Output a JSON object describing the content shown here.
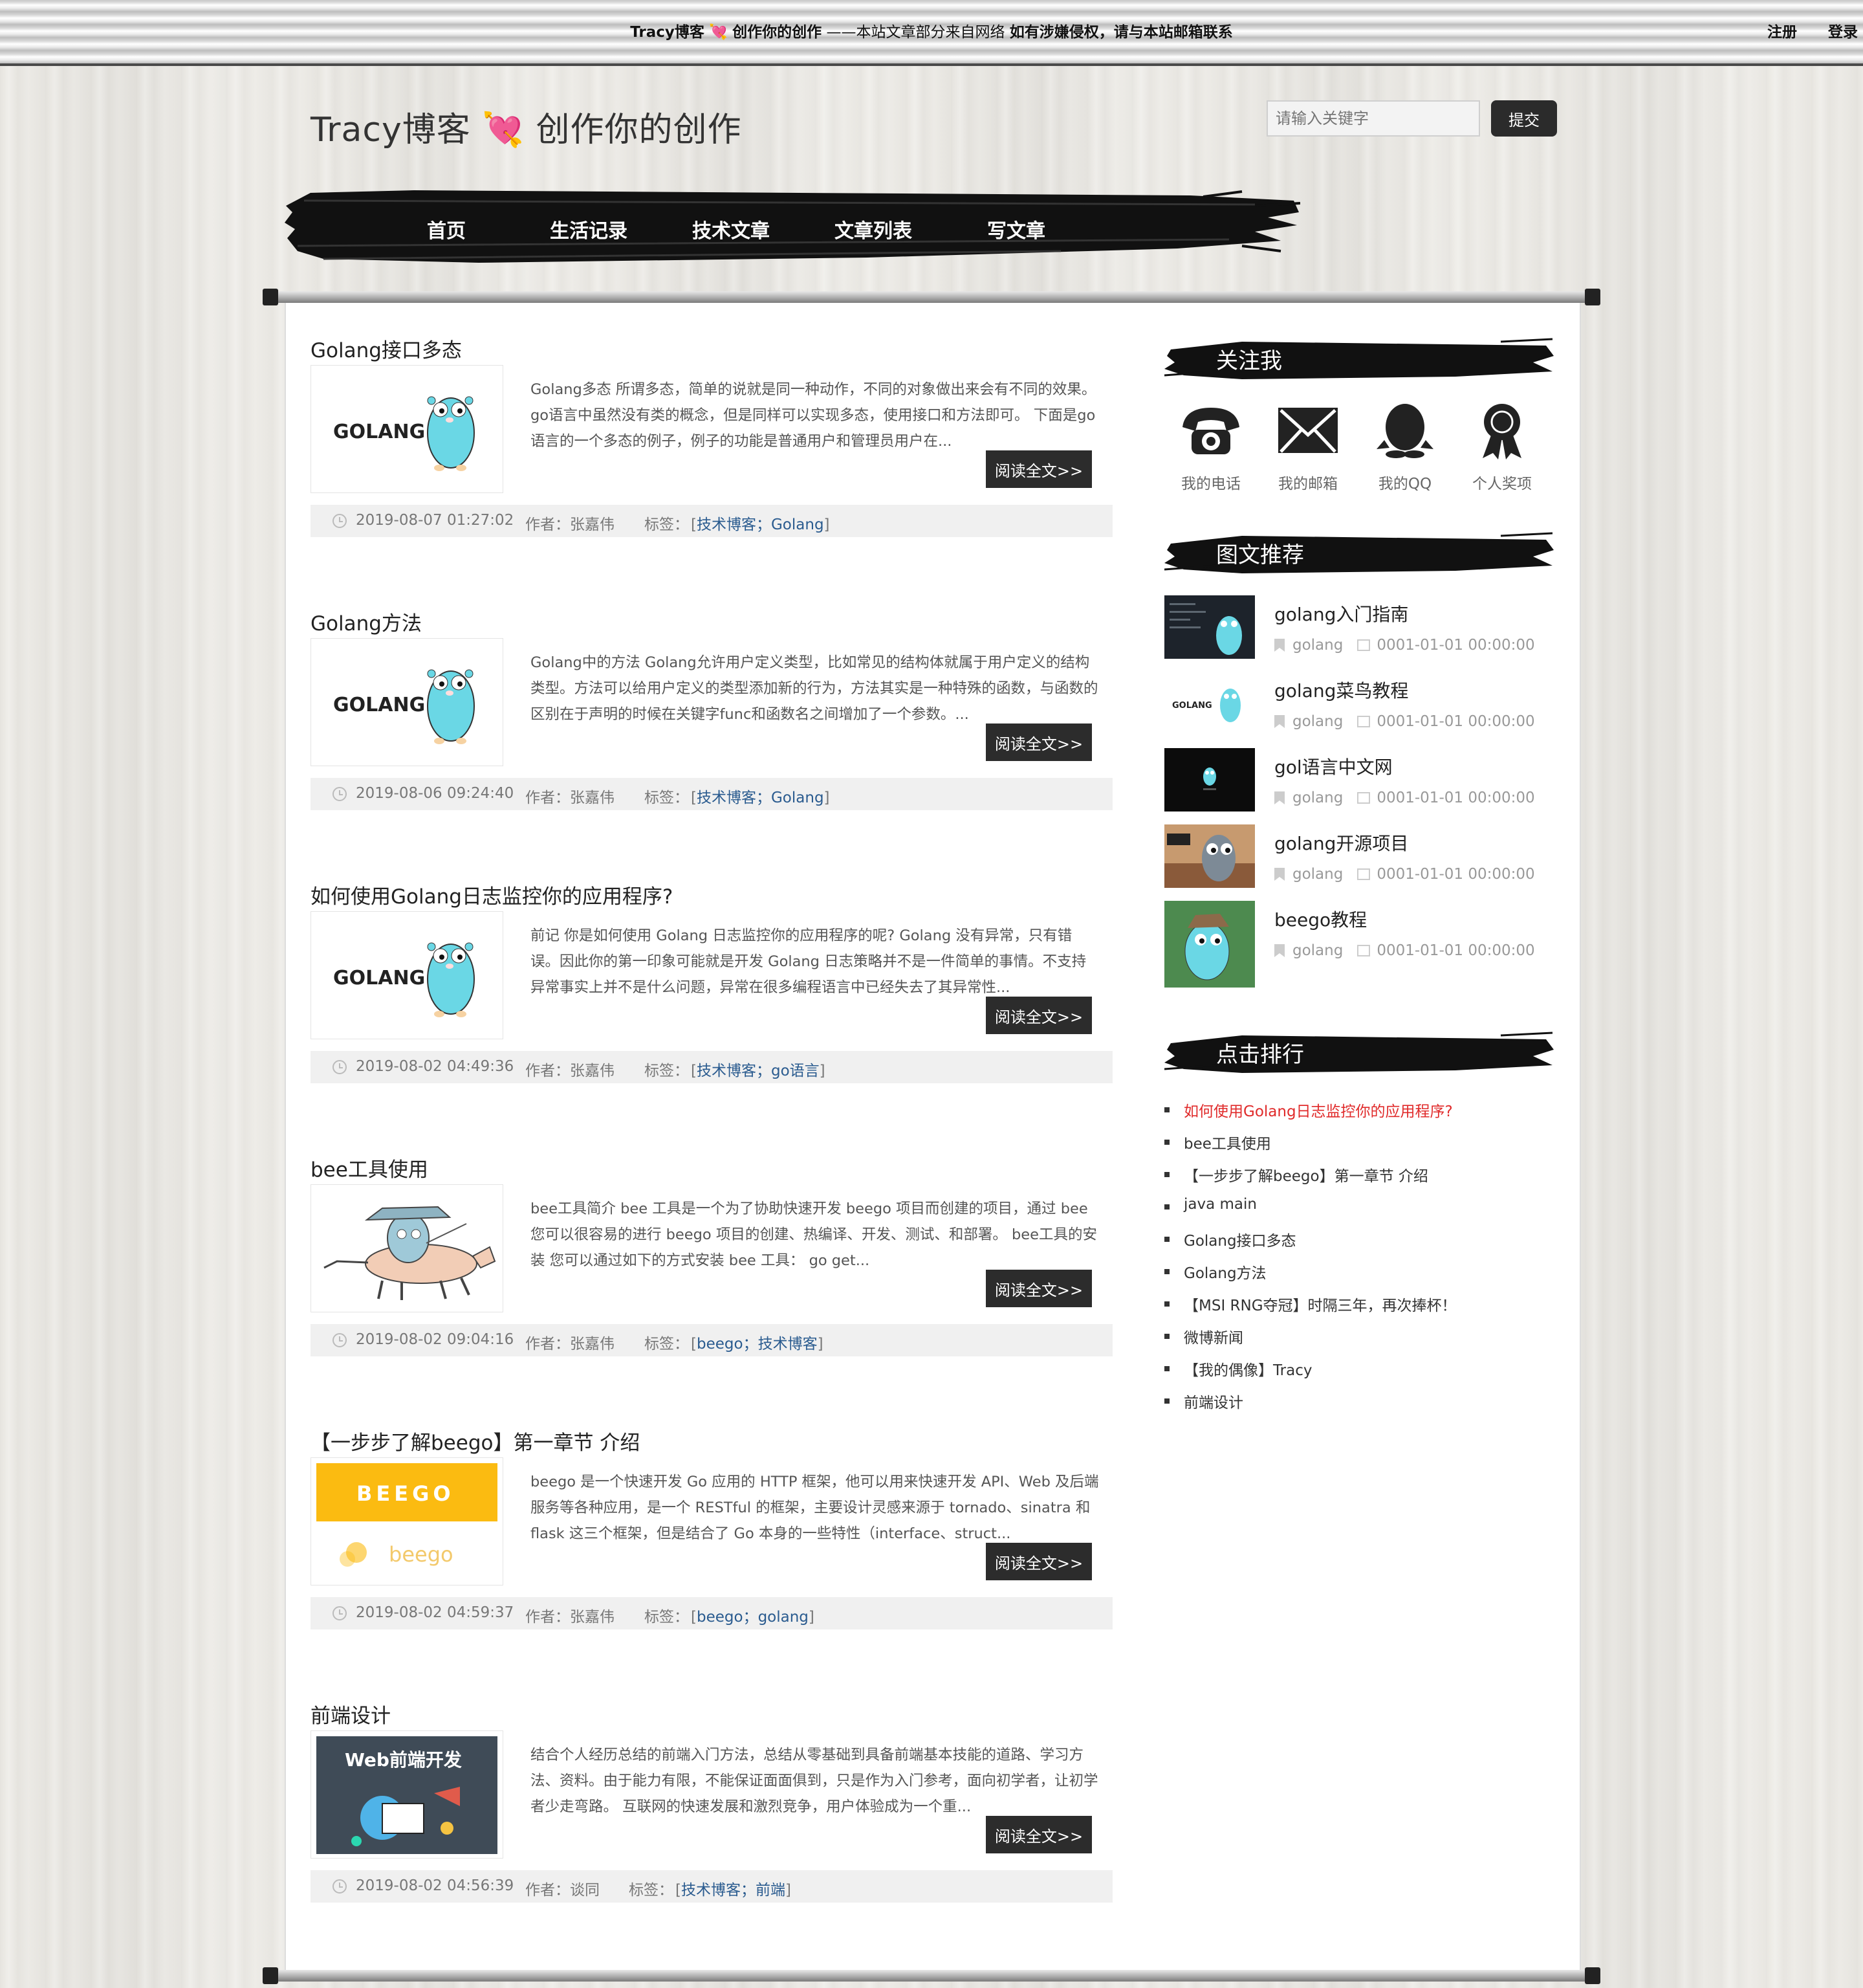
{
  "topbar": {
    "site_name": "Tracy博客",
    "heart": "💘",
    "site_slogan": "创作你的创作",
    "notice_mid": "——本站文章部分来自网络",
    "notice_bold": "如有涉嫌侵权，请与本站邮箱联系",
    "register": "注册",
    "login": "登录"
  },
  "header": {
    "logo_left": "Tracy博客",
    "logo_heart": "💘",
    "logo_right": "创作你的创作",
    "search_placeholder": "请输入关键字",
    "search_button": "提交"
  },
  "nav": [
    "首页",
    "生活记录",
    "技术文章",
    "文章列表",
    "写文章"
  ],
  "articles": [
    {
      "title": "Golang接口多态",
      "thumb": "golang",
      "summary": "Golang多态 所谓多态，简单的说就是同一种动作，不同的对象做出来会有不同的效果。go语言中虽然没有类的概念，但是同样可以实现多态，使用接口和方法即可。 下面是go语言的一个多态的例子，例子的功能是普通用户和管理员用户在...",
      "read": "阅读全文>>",
      "date": "2019-08-07 01:27:02",
      "author_label": "作者：",
      "author": "张嘉伟",
      "tags_label": "标签：",
      "tags": [
        "技术博客",
        "Golang"
      ]
    },
    {
      "title": "Golang方法",
      "thumb": "golang",
      "summary": "Golang中的方法 Golang允许用户定义类型，比如常见的结构体就属于用户定义的结构类型。方法可以给用户定义的类型添加新的行为，方法其实是一种特殊的函数，与函数的区别在于声明的时候在关键字func和函数名之间增加了一个参数。...",
      "read": "阅读全文>>",
      "date": "2019-08-06 09:24:40",
      "author_label": "作者：",
      "author": "张嘉伟",
      "tags_label": "标签：",
      "tags": [
        "技术博客",
        "Golang"
      ]
    },
    {
      "title": "如何使用Golang日志监控你的应用程序?",
      "thumb": "golang",
      "summary": "前记 你是如何使用 Golang 日志监控你的应用程序的呢? Golang 没有异常，只有错误。因此你的第一印象可能就是开发 Golang 日志策略并不是一件简单的事情。不支持异常事实上并不是什么问题，异常在很多编程语言中已经失去了其异常性...",
      "read": "阅读全文>>",
      "date": "2019-08-02 04:49:36",
      "author_label": "作者：",
      "author": "张嘉伟",
      "tags_label": "标签：",
      "tags": [
        "技术博客",
        "go语言"
      ]
    },
    {
      "title": "bee工具使用",
      "thumb": "bee",
      "summary": "bee工具简介 bee 工具是一个为了协助快速开发 beego 项目而创建的项目，通过 bee 您可以很容易的进行 beego 项目的创建、热编译、开发、测试、和部署。 bee工具的安装 您可以通过如下的方式安装 bee 工具：  go get...",
      "read": "阅读全文>>",
      "date": "2019-08-02 09:04:16",
      "author_label": "作者：",
      "author": "张嘉伟",
      "tags_label": "标签：",
      "tags": [
        "beego",
        "技术博客"
      ]
    },
    {
      "title": "【一步步了解beego】第一章节 介绍",
      "thumb": "beego",
      "summary": "beego 是一个快速开发 Go 应用的 HTTP 框架，他可以用来快速开发 API、Web 及后端服务等各种应用，是一个 RESTful 的框架，主要设计灵感来源于 tornado、sinatra 和 flask 这三个框架，但是结合了 Go 本身的一些特性（interface、struct...",
      "read": "阅读全文>>",
      "date": "2019-08-02 04:59:37",
      "author_label": "作者：",
      "author": "张嘉伟",
      "tags_label": "标签：",
      "tags": [
        "beego",
        "golang"
      ]
    },
    {
      "title": "前端设计",
      "thumb": "web",
      "summary": "结合个人经历总结的前端入门方法，总结从零基础到具备前端基本技能的道路、学习方法、资料。由于能力有限，不能保证面面俱到，只是作为入门参考，面向初学者，让初学者少走弯路。 互联网的快速发展和激烈竞争，用户体验成为一个重...",
      "read": "阅读全文>>",
      "date": "2019-08-02 04:56:39",
      "author_label": "作者：",
      "author": "谈同",
      "tags_label": "标签：",
      "tags": [
        "技术博客",
        "前端"
      ]
    }
  ],
  "thumb_text": {
    "golang_logo": "GOLANG",
    "beego_logo": "BEEGO",
    "beego_sub": "beego",
    "web_title": "Web前端开发"
  },
  "sidebar": {
    "follow_title": "关注我",
    "contacts": [
      {
        "icon": "phone-icon",
        "label": "我的电话"
      },
      {
        "icon": "mail-icon",
        "label": "我的邮箱"
      },
      {
        "icon": "qq-icon",
        "label": "我的QQ"
      },
      {
        "icon": "award-icon",
        "label": "个人奖项"
      }
    ],
    "recommend_title": "图文推荐",
    "recommend": [
      {
        "title": "golang入门指南",
        "tag": "golang",
        "date": "0001-01-01 00:00:00",
        "pic": "dark-code"
      },
      {
        "title": "golang菜鸟教程",
        "tag": "golang",
        "date": "0001-01-01 00:00:00",
        "pic": "golang-white"
      },
      {
        "title": "gol语言中文网",
        "tag": "golang",
        "date": "0001-01-01 00:00:00",
        "pic": "black-gopher"
      },
      {
        "title": "golang开源项目",
        "tag": "golang",
        "date": "0001-01-01 00:00:00",
        "pic": "photo-gopher"
      },
      {
        "title": "beego教程",
        "tag": "golang",
        "date": "0001-01-01 00:00:00",
        "pic": "green-gopher"
      }
    ],
    "rank_title": "点击排行",
    "rank": [
      "如何使用Golang日志监控你的应用程序?",
      "bee工具使用",
      "【一步步了解beego】第一章节 介绍",
      "java main",
      "Golang接口多态",
      "Golang方法",
      "【MSI RNG夺冠】时隔三年，再次捧杯！",
      "微博新闻",
      "【我的偶像】Tracy",
      "前端设计"
    ]
  },
  "colors": {
    "accent_dark": "#2c2c2c",
    "link": "#2a5b8f",
    "hot": "#e02a2a",
    "heart": "#e8417a",
    "gopher": "#6ad7e5"
  }
}
